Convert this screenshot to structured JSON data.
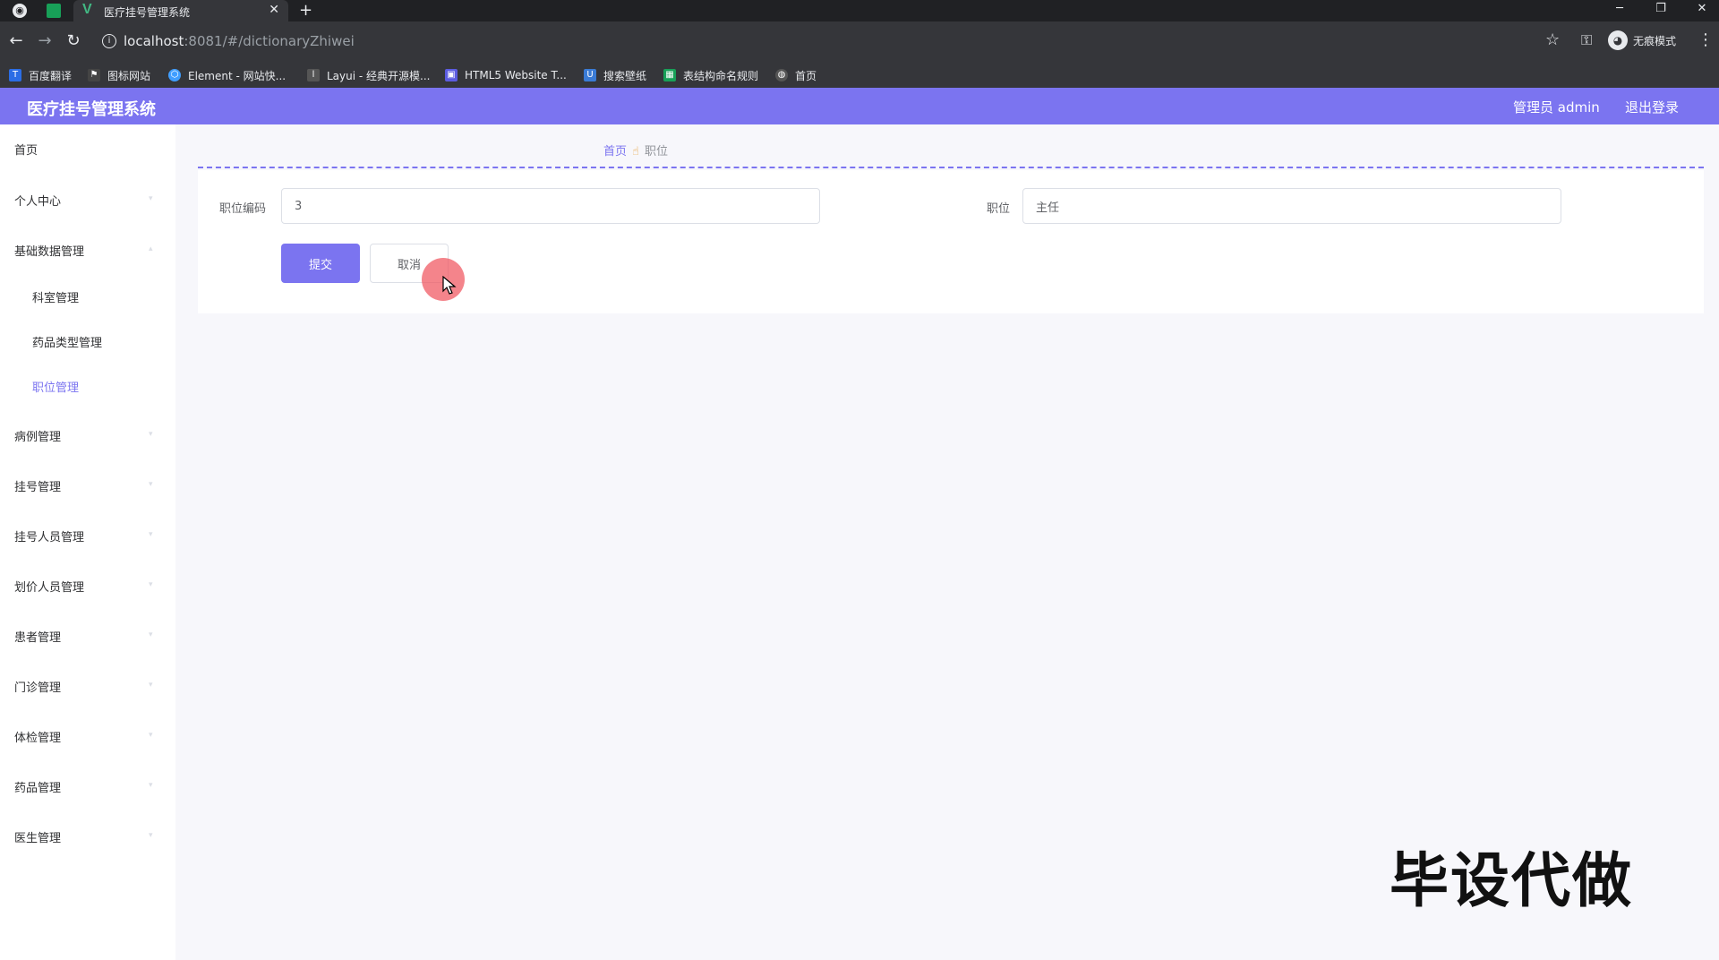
{
  "browser": {
    "tab_title": "医疗挂号管理系统",
    "url_host": "localhost",
    "url_rest": ":8081/#/dictionaryZhiwei",
    "incognito_label": "无痕模式",
    "bookmarks": [
      {
        "label": "百度翻译",
        "icon": "translate-icon",
        "color": "#2b6de5"
      },
      {
        "label": "图标网站",
        "icon": "flag-icon",
        "color": "#444444"
      },
      {
        "label": "Element - 网站快...",
        "icon": "element-icon",
        "color": "#409eff"
      },
      {
        "label": "Layui - 经典开源模...",
        "icon": "layui-icon",
        "color": "#555555"
      },
      {
        "label": "HTML5 Website T...",
        "icon": "html5-icon",
        "color": "#5c5ce0"
      },
      {
        "label": "搜索壁纸",
        "icon": "wallpaper-icon",
        "color": "#3a7bd5"
      },
      {
        "label": "表结构命名规则",
        "icon": "sheet-icon",
        "color": "#18a058"
      },
      {
        "label": "首页",
        "icon": "globe-icon",
        "color": "#555555"
      }
    ]
  },
  "header": {
    "title": "医疗挂号管理系统",
    "user": "管理员 admin",
    "logout": "退出登录"
  },
  "sidebar": {
    "items": [
      {
        "label": "首页",
        "has_arrow": false
      },
      {
        "label": "个人中心",
        "has_arrow": true
      },
      {
        "label": "基础数据管理",
        "has_arrow": true
      },
      {
        "label": "科室管理",
        "sub": true
      },
      {
        "label": "药品类型管理",
        "sub": true
      },
      {
        "label": "职位管理",
        "sub": true,
        "active": true
      },
      {
        "label": "病例管理",
        "has_arrow": true
      },
      {
        "label": "挂号管理",
        "has_arrow": true
      },
      {
        "label": "挂号人员管理",
        "has_arrow": true
      },
      {
        "label": "划价人员管理",
        "has_arrow": true
      },
      {
        "label": "患者管理",
        "has_arrow": true
      },
      {
        "label": "门诊管理",
        "has_arrow": true
      },
      {
        "label": "体检管理",
        "has_arrow": true
      },
      {
        "label": "药品管理",
        "has_arrow": true
      },
      {
        "label": "医生管理",
        "has_arrow": true
      }
    ]
  },
  "breadcrumb": {
    "home": "首页",
    "current": "职位"
  },
  "form": {
    "code_label": "职位编码",
    "code_value": "3",
    "position_label": "职位",
    "position_value": "主任",
    "submit": "提交",
    "cancel": "取消"
  },
  "watermark": "毕设代做",
  "colors": {
    "accent": "#7b74f0",
    "background": "#f7f7fb"
  }
}
